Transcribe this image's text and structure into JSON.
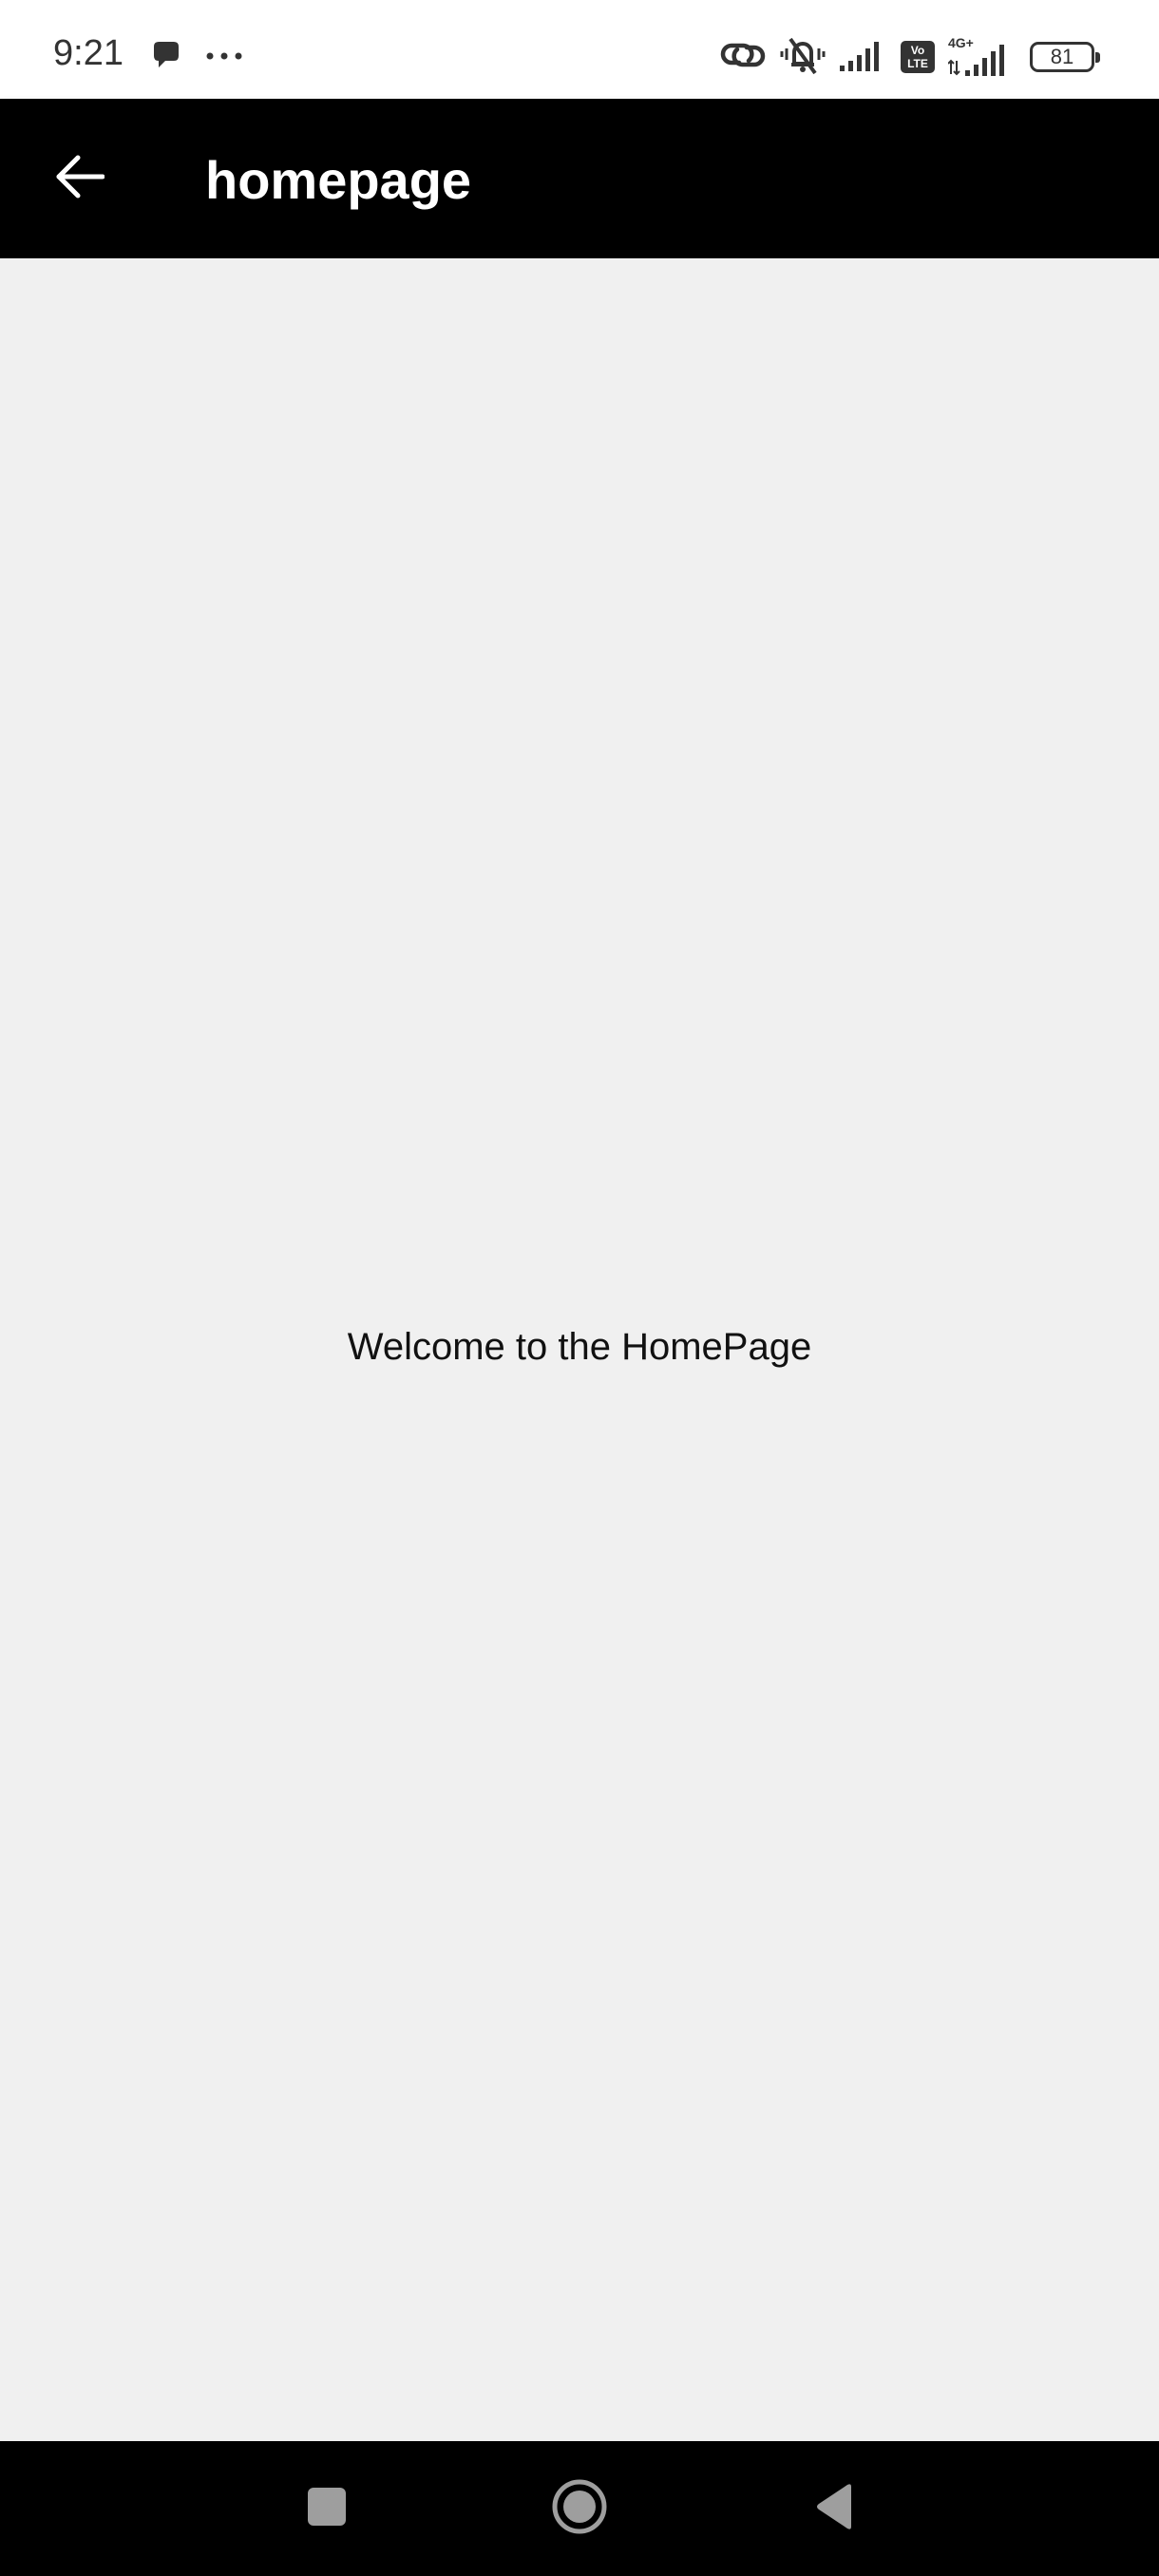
{
  "status_bar": {
    "time": "9:21",
    "battery_level": "81",
    "network_label": "4G+",
    "volte_line1": "Vo",
    "volte_line2": "LTE",
    "icons": [
      "message-icon",
      "more-dots-icon",
      "link-icon",
      "vibrate-mute-icon",
      "signal-icon",
      "volte-icon",
      "signal-4g-icon",
      "battery-icon"
    ]
  },
  "app_bar": {
    "title": "homepage",
    "back_icon": "arrow-left-icon"
  },
  "content": {
    "message": "Welcome to the HomePage"
  },
  "nav_bar": {
    "icons": [
      "recent-apps-icon",
      "home-icon",
      "back-triangle-icon"
    ]
  },
  "colors": {
    "app_bar_bg": "#000000",
    "content_bg": "#f0f0f0",
    "status_bar_bg": "#ffffff",
    "nav_bar_bg": "#000000"
  }
}
